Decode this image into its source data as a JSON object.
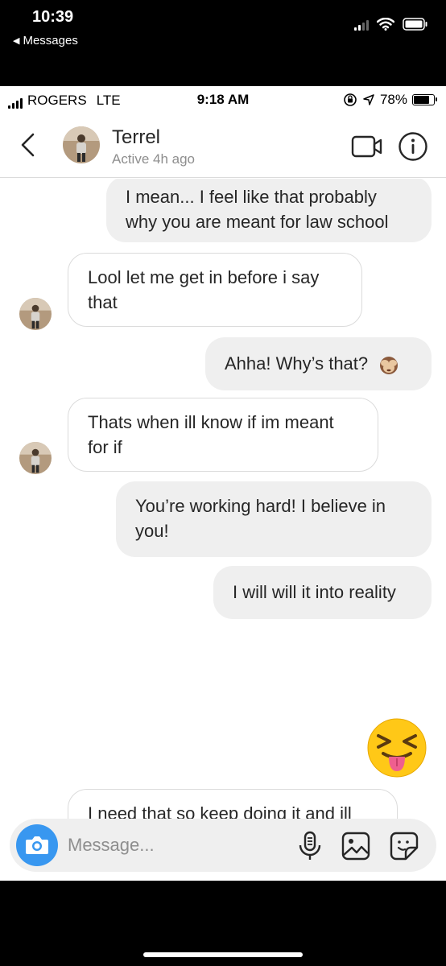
{
  "outer_status": {
    "time": "10:39",
    "back_label": "Messages"
  },
  "inner_status": {
    "carrier": "ROGERS",
    "network": "LTE",
    "time": "9:18 AM",
    "battery": "78%",
    "battery_level": 0.78
  },
  "header": {
    "contact_name": "Terrel",
    "contact_status": "Active 4h ago"
  },
  "messages": [
    {
      "from": "me",
      "text": "I mean... I feel like that probably why you are meant for law school"
    },
    {
      "from": "them",
      "text": "Lool let me get in before i say that"
    },
    {
      "from": "me",
      "text": "Ahha! Why’s that?",
      "emoji": "see-no-evil-monkey"
    },
    {
      "from": "them",
      "text": "Thats when ill know if im meant for if"
    },
    {
      "from": "me",
      "text": "You’re working hard! I believe in you!"
    },
    {
      "from": "me",
      "text": "I will will it into reality"
    },
    {
      "from": "me",
      "emoji": "squinting-face-with-tongue"
    },
    {
      "from": "them",
      "text": "I need that so keep doing it and ill give all the credit in my obligatory twitter post about being accepted"
    }
  ],
  "composer": {
    "placeholder": "Message..."
  },
  "colors": {
    "accent": "#3897f0",
    "outgoing_bubble": "#efefef",
    "incoming_border": "#dbdbdb",
    "text": "#262626",
    "secondary_text": "#8e8e8e"
  }
}
